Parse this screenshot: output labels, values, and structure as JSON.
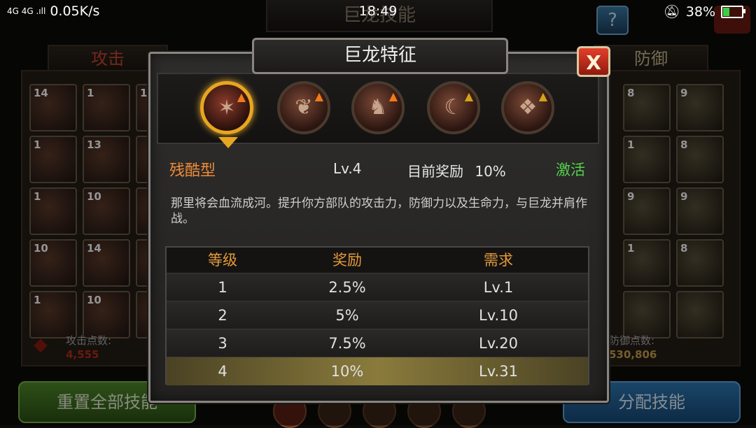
{
  "status_bar": {
    "signal": "4G 4G .ıll",
    "speed": "0.05K/s",
    "time": "18:49",
    "alarm_icon": "bell-slash-icon",
    "battery": "38%",
    "battery_level": 0.38,
    "battery_color": "#3ccf46"
  },
  "background": {
    "screen_title": "巨龙技能",
    "help_label": "?",
    "attack_tab": "攻击",
    "defense_tab": "防御",
    "attack_tiles": [
      [
        "14",
        "1",
        "1"
      ],
      [
        "1",
        "13",
        ""
      ],
      [
        "1",
        "10",
        ""
      ],
      [
        "10",
        "14",
        ""
      ],
      [
        "1",
        "10",
        ""
      ]
    ],
    "defense_tiles": [
      [
        "8",
        "9"
      ],
      [
        "1",
        "8"
      ],
      [
        "9",
        "9"
      ],
      [
        "1",
        "8"
      ],
      [
        "",
        ""
      ]
    ],
    "attack_points_label": "攻击点数:",
    "attack_points": "4,555",
    "defense_points_label": "防御点数:",
    "defense_points": "530,806",
    "reset_button": "重置全部技能",
    "assign_button": "分配技能"
  },
  "dialog": {
    "title": "巨龙特征",
    "close_label": "X",
    "traits": [
      {
        "icon": "claw-icon",
        "active": true
      },
      {
        "icon": "dragon-wing-icon",
        "active": false
      },
      {
        "icon": "dragon-head-icon",
        "active": false
      },
      {
        "icon": "fang-icon",
        "active": false
      },
      {
        "icon": "scale-armor-icon",
        "active": false
      }
    ],
    "trait_name": "残酷型",
    "level": "Lv.4",
    "current_bonus_label": "目前奖励",
    "current_bonus": "10%",
    "status": "激活",
    "description": "那里将会血流成河。提升你方部队的攻击力，防御力以及生命力，与巨龙并肩作战。",
    "table": {
      "headers": [
        "等级",
        "奖励",
        "需求"
      ],
      "rows": [
        [
          "1",
          "2.5%",
          "Lv.1"
        ],
        [
          "2",
          "5%",
          "Lv.10"
        ],
        [
          "3",
          "7.5%",
          "Lv.20"
        ],
        [
          "4",
          "10%",
          "Lv.31"
        ]
      ],
      "current_row": 4
    }
  }
}
